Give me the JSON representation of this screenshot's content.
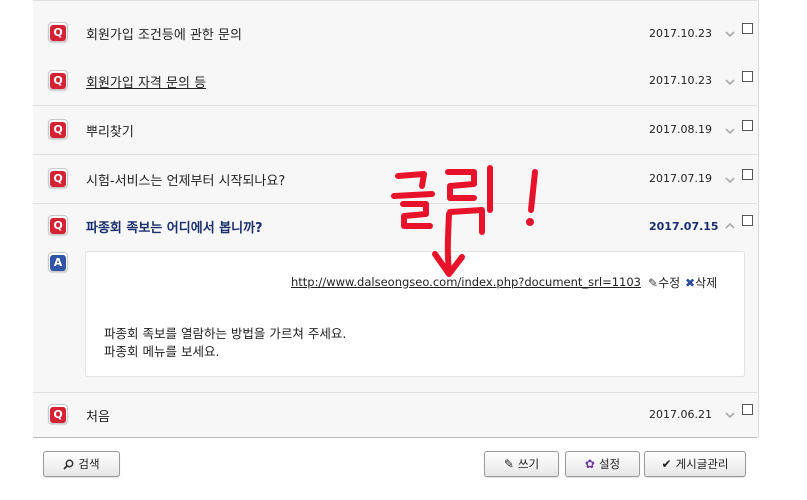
{
  "questions": [
    {
      "title": "회원가입 조건등에 관한 문의",
      "date": "2017.10.23"
    },
    {
      "title": "회원가입 자격 문의 등",
      "date": "2017.10.23"
    },
    {
      "title": "뿌리찾기",
      "date": "2017.08.19"
    },
    {
      "title": "시험-서비스는 언제부터 시작되나요?",
      "date": "2017.07.19"
    },
    {
      "title": "파종회 족보는 어디에서 봅니까?",
      "date": "2017.07.15"
    },
    {
      "title": "처음",
      "date": "2017.06.21"
    }
  ],
  "q_label": "Q",
  "a_label": "A",
  "answer": {
    "url": "http://www.dalseongseo.com/index.php?document_srl=1103",
    "edit_label": "수정",
    "delete_label": "삭제",
    "lines": [
      "파종회 족보를 열람하는 방법을 가르쳐 주세요.",
      "파종회 메뉴를 보세요."
    ]
  },
  "buttons": {
    "search": "검색",
    "write": "쓰기",
    "settings": "설정",
    "admin": "게시글관리"
  },
  "annotation": {
    "text": "클릭!",
    "color": "#e8132a"
  },
  "colors": {
    "q_icon": "#d42233",
    "a_icon": "#2f56a6",
    "active_title": "#1a2f6e"
  }
}
